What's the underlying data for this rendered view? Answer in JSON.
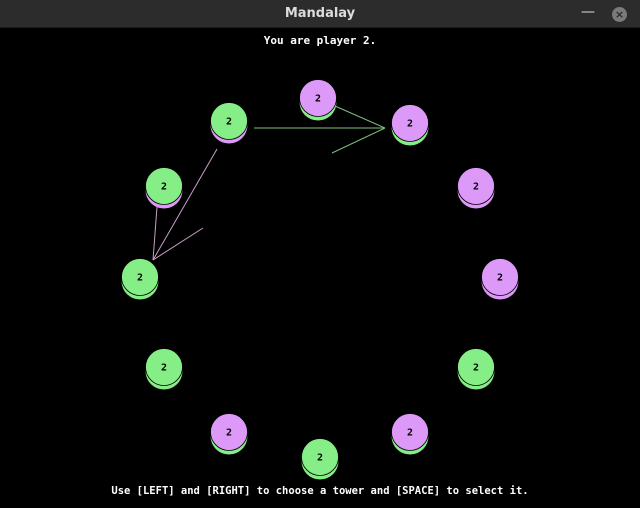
{
  "window": {
    "title": "Mandalay",
    "minimize_glyph": "—",
    "close_glyph": "×"
  },
  "status_text": "You are player 2.",
  "instructions_text": "Use [LEFT] and [RIGHT] to choose a tower and [SPACE] to select it.",
  "colors": {
    "player_green": "#86ee86",
    "player_purple": "#dd99f7",
    "arrow": "#7fbf7f",
    "background": "#000000"
  },
  "towers": [
    {
      "id": "t0",
      "top": "purple",
      "under": "green",
      "count": "2"
    },
    {
      "id": "t1",
      "top": "purple",
      "under": "green",
      "count": "2"
    },
    {
      "id": "t2",
      "top": "purple",
      "under": "purple",
      "count": "2"
    },
    {
      "id": "t3",
      "top": "purple",
      "under": "purple",
      "count": "2"
    },
    {
      "id": "t4",
      "top": "green",
      "under": "green",
      "count": "2"
    },
    {
      "id": "t5",
      "top": "purple",
      "under": "green",
      "count": "2"
    },
    {
      "id": "t6",
      "top": "green",
      "under": "green",
      "count": "2"
    },
    {
      "id": "t7",
      "top": "purple",
      "under": "green",
      "count": "2"
    },
    {
      "id": "t8",
      "top": "green",
      "under": "green",
      "count": "2"
    },
    {
      "id": "t9",
      "top": "green",
      "under": "green",
      "count": "2"
    },
    {
      "id": "t10",
      "top": "green",
      "under": "purple",
      "count": "2"
    },
    {
      "id": "t11",
      "top": "green",
      "under": "purple",
      "count": "2"
    }
  ]
}
